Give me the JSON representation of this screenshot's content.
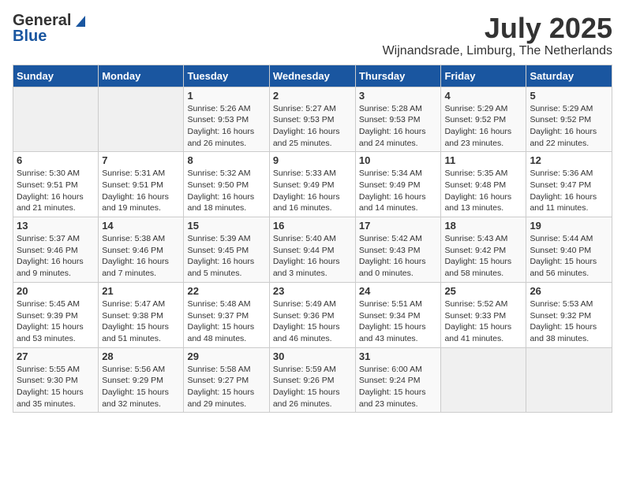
{
  "header": {
    "logo_general": "General",
    "logo_blue": "Blue",
    "month_title": "July 2025",
    "location": "Wijnandsrade, Limburg, The Netherlands"
  },
  "weekdays": [
    "Sunday",
    "Monday",
    "Tuesday",
    "Wednesday",
    "Thursday",
    "Friday",
    "Saturday"
  ],
  "weeks": [
    [
      {
        "day": "",
        "sunrise": "",
        "sunset": "",
        "daylight": ""
      },
      {
        "day": "",
        "sunrise": "",
        "sunset": "",
        "daylight": ""
      },
      {
        "day": "1",
        "sunrise": "Sunrise: 5:26 AM",
        "sunset": "Sunset: 9:53 PM",
        "daylight": "Daylight: 16 hours and 26 minutes."
      },
      {
        "day": "2",
        "sunrise": "Sunrise: 5:27 AM",
        "sunset": "Sunset: 9:53 PM",
        "daylight": "Daylight: 16 hours and 25 minutes."
      },
      {
        "day": "3",
        "sunrise": "Sunrise: 5:28 AM",
        "sunset": "Sunset: 9:53 PM",
        "daylight": "Daylight: 16 hours and 24 minutes."
      },
      {
        "day": "4",
        "sunrise": "Sunrise: 5:29 AM",
        "sunset": "Sunset: 9:52 PM",
        "daylight": "Daylight: 16 hours and 23 minutes."
      },
      {
        "day": "5",
        "sunrise": "Sunrise: 5:29 AM",
        "sunset": "Sunset: 9:52 PM",
        "daylight": "Daylight: 16 hours and 22 minutes."
      }
    ],
    [
      {
        "day": "6",
        "sunrise": "Sunrise: 5:30 AM",
        "sunset": "Sunset: 9:51 PM",
        "daylight": "Daylight: 16 hours and 21 minutes."
      },
      {
        "day": "7",
        "sunrise": "Sunrise: 5:31 AM",
        "sunset": "Sunset: 9:51 PM",
        "daylight": "Daylight: 16 hours and 19 minutes."
      },
      {
        "day": "8",
        "sunrise": "Sunrise: 5:32 AM",
        "sunset": "Sunset: 9:50 PM",
        "daylight": "Daylight: 16 hours and 18 minutes."
      },
      {
        "day": "9",
        "sunrise": "Sunrise: 5:33 AM",
        "sunset": "Sunset: 9:49 PM",
        "daylight": "Daylight: 16 hours and 16 minutes."
      },
      {
        "day": "10",
        "sunrise": "Sunrise: 5:34 AM",
        "sunset": "Sunset: 9:49 PM",
        "daylight": "Daylight: 16 hours and 14 minutes."
      },
      {
        "day": "11",
        "sunrise": "Sunrise: 5:35 AM",
        "sunset": "Sunset: 9:48 PM",
        "daylight": "Daylight: 16 hours and 13 minutes."
      },
      {
        "day": "12",
        "sunrise": "Sunrise: 5:36 AM",
        "sunset": "Sunset: 9:47 PM",
        "daylight": "Daylight: 16 hours and 11 minutes."
      }
    ],
    [
      {
        "day": "13",
        "sunrise": "Sunrise: 5:37 AM",
        "sunset": "Sunset: 9:46 PM",
        "daylight": "Daylight: 16 hours and 9 minutes."
      },
      {
        "day": "14",
        "sunrise": "Sunrise: 5:38 AM",
        "sunset": "Sunset: 9:46 PM",
        "daylight": "Daylight: 16 hours and 7 minutes."
      },
      {
        "day": "15",
        "sunrise": "Sunrise: 5:39 AM",
        "sunset": "Sunset: 9:45 PM",
        "daylight": "Daylight: 16 hours and 5 minutes."
      },
      {
        "day": "16",
        "sunrise": "Sunrise: 5:40 AM",
        "sunset": "Sunset: 9:44 PM",
        "daylight": "Daylight: 16 hours and 3 minutes."
      },
      {
        "day": "17",
        "sunrise": "Sunrise: 5:42 AM",
        "sunset": "Sunset: 9:43 PM",
        "daylight": "Daylight: 16 hours and 0 minutes."
      },
      {
        "day": "18",
        "sunrise": "Sunrise: 5:43 AM",
        "sunset": "Sunset: 9:42 PM",
        "daylight": "Daylight: 15 hours and 58 minutes."
      },
      {
        "day": "19",
        "sunrise": "Sunrise: 5:44 AM",
        "sunset": "Sunset: 9:40 PM",
        "daylight": "Daylight: 15 hours and 56 minutes."
      }
    ],
    [
      {
        "day": "20",
        "sunrise": "Sunrise: 5:45 AM",
        "sunset": "Sunset: 9:39 PM",
        "daylight": "Daylight: 15 hours and 53 minutes."
      },
      {
        "day": "21",
        "sunrise": "Sunrise: 5:47 AM",
        "sunset": "Sunset: 9:38 PM",
        "daylight": "Daylight: 15 hours and 51 minutes."
      },
      {
        "day": "22",
        "sunrise": "Sunrise: 5:48 AM",
        "sunset": "Sunset: 9:37 PM",
        "daylight": "Daylight: 15 hours and 48 minutes."
      },
      {
        "day": "23",
        "sunrise": "Sunrise: 5:49 AM",
        "sunset": "Sunset: 9:36 PM",
        "daylight": "Daylight: 15 hours and 46 minutes."
      },
      {
        "day": "24",
        "sunrise": "Sunrise: 5:51 AM",
        "sunset": "Sunset: 9:34 PM",
        "daylight": "Daylight: 15 hours and 43 minutes."
      },
      {
        "day": "25",
        "sunrise": "Sunrise: 5:52 AM",
        "sunset": "Sunset: 9:33 PM",
        "daylight": "Daylight: 15 hours and 41 minutes."
      },
      {
        "day": "26",
        "sunrise": "Sunrise: 5:53 AM",
        "sunset": "Sunset: 9:32 PM",
        "daylight": "Daylight: 15 hours and 38 minutes."
      }
    ],
    [
      {
        "day": "27",
        "sunrise": "Sunrise: 5:55 AM",
        "sunset": "Sunset: 9:30 PM",
        "daylight": "Daylight: 15 hours and 35 minutes."
      },
      {
        "day": "28",
        "sunrise": "Sunrise: 5:56 AM",
        "sunset": "Sunset: 9:29 PM",
        "daylight": "Daylight: 15 hours and 32 minutes."
      },
      {
        "day": "29",
        "sunrise": "Sunrise: 5:58 AM",
        "sunset": "Sunset: 9:27 PM",
        "daylight": "Daylight: 15 hours and 29 minutes."
      },
      {
        "day": "30",
        "sunrise": "Sunrise: 5:59 AM",
        "sunset": "Sunset: 9:26 PM",
        "daylight": "Daylight: 15 hours and 26 minutes."
      },
      {
        "day": "31",
        "sunrise": "Sunrise: 6:00 AM",
        "sunset": "Sunset: 9:24 PM",
        "daylight": "Daylight: 15 hours and 23 minutes."
      },
      {
        "day": "",
        "sunrise": "",
        "sunset": "",
        "daylight": ""
      },
      {
        "day": "",
        "sunrise": "",
        "sunset": "",
        "daylight": ""
      }
    ]
  ]
}
